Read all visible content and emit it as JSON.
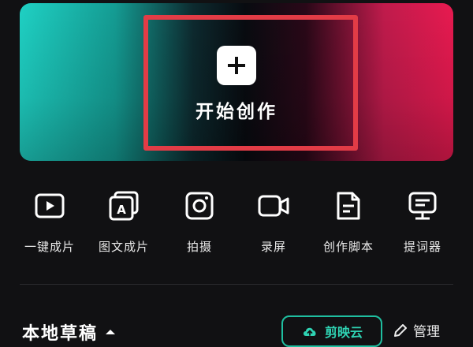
{
  "banner": {
    "create_label": "开始创作",
    "plus_symbol": "+"
  },
  "tools": [
    {
      "label": "一键成片",
      "icon": "play-video-icon"
    },
    {
      "label": "图文成片",
      "icon": "text-to-video-icon"
    },
    {
      "label": "拍摄",
      "icon": "camera-icon"
    },
    {
      "label": "录屏",
      "icon": "screen-record-icon"
    },
    {
      "label": "创作脚本",
      "icon": "script-document-icon"
    },
    {
      "label": "提词器",
      "icon": "teleprompter-icon"
    }
  ],
  "drafts": {
    "title": "本地草稿",
    "cloud_label": "剪映云",
    "manage_label": "管理"
  },
  "colors": {
    "background": "#111113",
    "highlight": "#e23c46",
    "accent": "#2fd3b3"
  }
}
